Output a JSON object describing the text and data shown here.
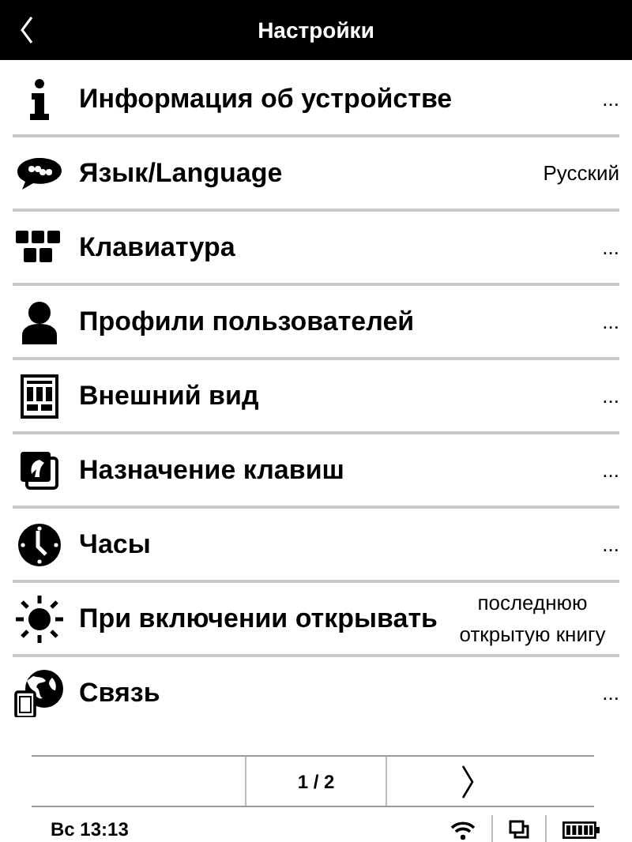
{
  "header": {
    "title": "Настройки"
  },
  "items": [
    {
      "label": "Информация об устройстве",
      "value": "..."
    },
    {
      "label": "Язык/Language",
      "value": "Русский"
    },
    {
      "label": "Клавиатура",
      "value": "..."
    },
    {
      "label": "Профили пользователей",
      "value": "..."
    },
    {
      "label": "Внешний вид",
      "value": "..."
    },
    {
      "label": "Назначение клавиш",
      "value": "..."
    },
    {
      "label": "Часы",
      "value": "..."
    },
    {
      "label": "При включении открывать",
      "value": "последнюю открытую книгу"
    },
    {
      "label": "Связь",
      "value": "..."
    }
  ],
  "pager": {
    "page": "1 / 2"
  },
  "status_bar": {
    "time": "Вс 13:13"
  }
}
